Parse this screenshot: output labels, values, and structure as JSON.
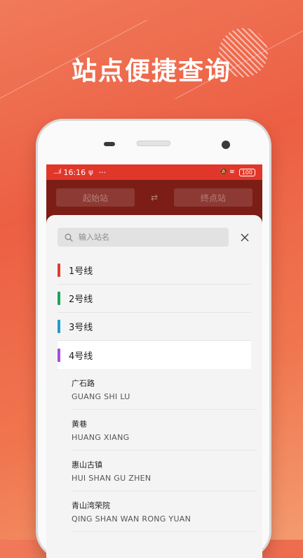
{
  "promo": {
    "headline": "站点便捷查询"
  },
  "status_bar": {
    "signal": "....ıl",
    "time": "16:16",
    "usb": "ψ",
    "more": "···",
    "right_icons": "🔕 ≋",
    "battery": "100"
  },
  "route": {
    "start_placeholder": "起始站",
    "swap_symbol": "⇄",
    "end_placeholder": "终点站"
  },
  "search": {
    "placeholder": "输入站名"
  },
  "lines": [
    {
      "label": "1号线",
      "color": "#e23a2e"
    },
    {
      "label": "2号线",
      "color": "#1ea35a"
    },
    {
      "label": "3号线",
      "color": "#1f9bd6"
    },
    {
      "label": "4号线",
      "color": "#a64be0"
    }
  ],
  "stations": [
    {
      "name": "广石路",
      "pinyin": "GUANG SHI LU"
    },
    {
      "name": "黄巷",
      "pinyin": "HUANG XIANG"
    },
    {
      "name": "惠山古镇",
      "pinyin": "HUI SHAN GU ZHEN"
    },
    {
      "name": "青山湾荣院",
      "pinyin": "QING SHAN WAN RONG YUAN"
    }
  ]
}
